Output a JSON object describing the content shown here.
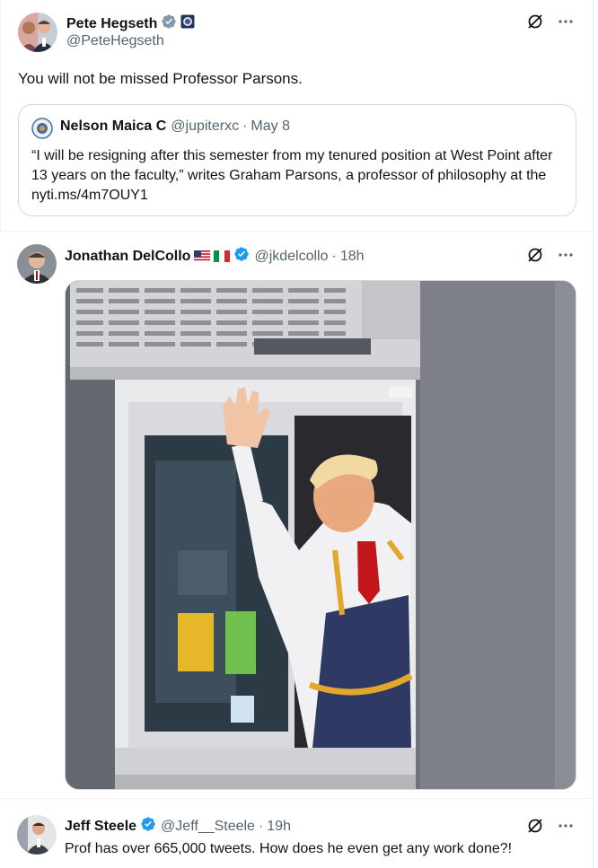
{
  "posts": [
    {
      "display_name": "Pete Hegseth",
      "handle": "@PeteHegseth",
      "verified_badge": "gray-check",
      "affiliate_badge": "dod-seal",
      "text": "You will not be missed Professor Parsons.",
      "quote": {
        "display_name": "Nelson Maica C",
        "handle": "@jupiterxc",
        "date": "May 8",
        "text": "“I will be resigning after this semester from my tenured position at West Point after 13 years on the faculty,” writes Graham Parsons, a professor of philosophy at the nyti.ms/4m7OUY1"
      }
    },
    {
      "display_name": "Jonathan DelCollo",
      "flags": [
        "us-flag",
        "italy-flag"
      ],
      "verified_badge": "blue-check",
      "handle": "@jkdelcollo",
      "time": "18h",
      "media_alt": "Man in white shirt, red tie and apron waving from a drive-thru window"
    },
    {
      "display_name": "Jeff Steele",
      "verified_badge": "blue-check",
      "handle": "@Jeff__Steele",
      "time": "19h",
      "text": "Prof has over 665,000 tweets. How does he even get any work done?!"
    }
  ],
  "icons": {
    "grok": "grok-icon",
    "more": "more-icon"
  },
  "colors": {
    "text_primary": "#0f1419",
    "text_secondary": "#536471",
    "verified_blue": "#1d9bf0",
    "verified_gray": "#829aab",
    "border": "#cfd9de"
  }
}
